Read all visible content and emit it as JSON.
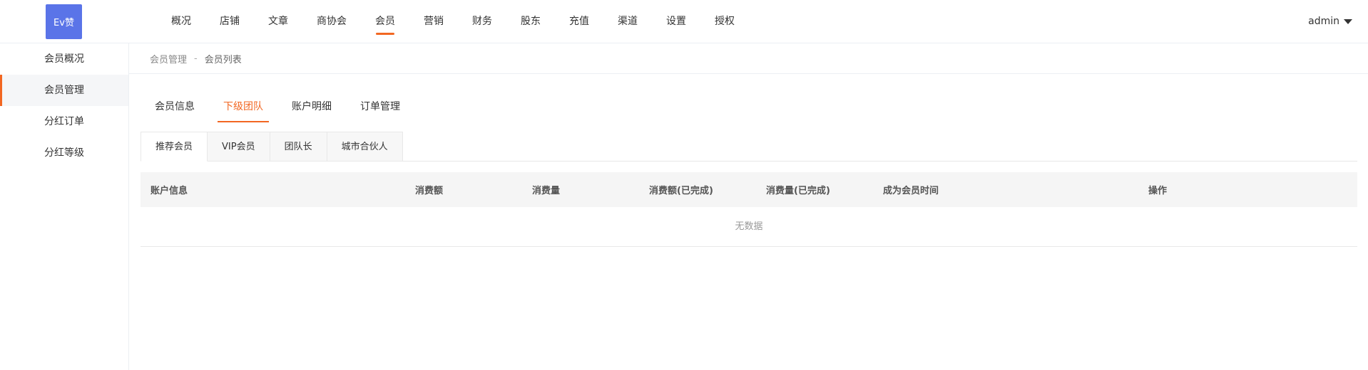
{
  "logo": {
    "text": "Ev赞"
  },
  "header": {
    "nav": [
      "概况",
      "店铺",
      "文章",
      "商协会",
      "会员",
      "营销",
      "财务",
      "股东",
      "充值",
      "渠道",
      "设置",
      "授权"
    ],
    "active_index": 4,
    "user": "admin"
  },
  "sidebar": {
    "items": [
      "会员概况",
      "会员管理",
      "分红订单",
      "分红等级"
    ],
    "active_index": 1
  },
  "breadcrumb": {
    "parent": "会员管理",
    "separator": "-",
    "current": "会员列表"
  },
  "tabs": {
    "items": [
      "会员信息",
      "下级团队",
      "账户明细",
      "订单管理"
    ],
    "active_index": 1
  },
  "subtabs": {
    "items": [
      "推荐会员",
      "VIP会员",
      "团队长",
      "城市合伙人"
    ],
    "active_index": 0
  },
  "table": {
    "columns": [
      "账户信息",
      "消费额",
      "消费量",
      "消费额(已完成)",
      "消费量(已完成)",
      "成为会员时间",
      "操作"
    ],
    "empty_text": "无数据"
  },
  "colors": {
    "accent": "#f26722",
    "logo_bg": "#5a74e8"
  }
}
